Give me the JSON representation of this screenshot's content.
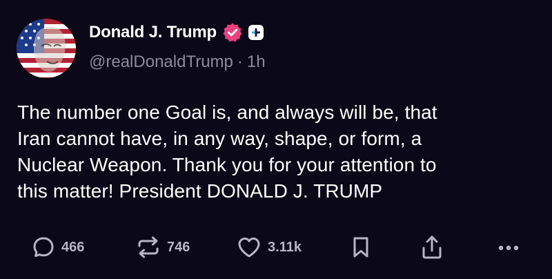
{
  "post": {
    "author": {
      "display_name": "Donald J. Trump",
      "handle": "@realDonaldTrump",
      "separator": "·",
      "time_ago": "1h",
      "avatar_icon": "avatar-flag-portrait",
      "verified_icon": "verified-badge-icon",
      "verified_color": "#e8417d",
      "plus_icon": "plus-badge-icon"
    },
    "text": "The number one Goal is, and always will be, that\nIran cannot have, in any way, shape, or form, a\nNuclear Weapon. Thank you for your attention to\nthis matter! President DONALD J. TRUMP",
    "actions": {
      "reply": {
        "icon": "comment-icon",
        "count": "466"
      },
      "repost": {
        "icon": "repost-icon",
        "count": "746"
      },
      "like": {
        "icon": "heart-icon",
        "count": "3.11k"
      },
      "bookmark": {
        "icon": "bookmark-icon"
      },
      "share": {
        "icon": "share-icon"
      },
      "more": {
        "icon": "more-dots-icon"
      }
    }
  },
  "colors": {
    "background": "#0b0818",
    "text": "#ffffff",
    "muted": "#8e8b9c",
    "action": "#b8b5c6"
  }
}
